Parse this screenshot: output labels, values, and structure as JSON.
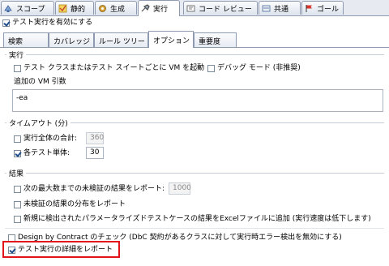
{
  "top_tabs": [
    {
      "label": "スコープ",
      "icon": "scope-icon"
    },
    {
      "label": "静的",
      "icon": "static-icon"
    },
    {
      "label": "生成",
      "icon": "generate-icon"
    },
    {
      "label": "実行",
      "icon": "execute-icon",
      "active": true
    },
    {
      "label": "コード レビュー",
      "icon": "code-review-icon"
    },
    {
      "label": "共通",
      "icon": "common-icon"
    },
    {
      "label": "ゴール",
      "icon": "goal-icon"
    }
  ],
  "enable_test_run": {
    "label": "テスト実行を有効にする",
    "checked": true
  },
  "sub_tabs": [
    "検索",
    "カバレッジ",
    "ルール ツリー",
    "オプション",
    "重要度"
  ],
  "active_sub_tab": "オプション",
  "execution": {
    "title": "実行",
    "launch_vm": {
      "label": "テスト クラスまたはテスト スイートごとに VM を起動",
      "checked": false
    },
    "debug_mode": {
      "label": "デバッグ モード (非推奨)",
      "checked": false
    },
    "vm_args_label": "追加の VM 引数",
    "vm_args_value": "-ea"
  },
  "timeout": {
    "title": "タイムアウト (分)",
    "total": {
      "label": "実行全体の合計:",
      "checked": false,
      "value": "360"
    },
    "per_test": {
      "label": "各テスト単体:",
      "checked": true,
      "value": "30"
    }
  },
  "results": {
    "title": "結果",
    "max_unverified": {
      "label": "次の最大数までの未検証の結果をレポート:",
      "checked": false,
      "value": "1000"
    },
    "report_distribution": {
      "label": "未検証の結果の分布をレポート",
      "checked": false
    },
    "report_excel": {
      "label": "新規に検出されたパラメータライズドテストケースの結果をExcelファイルに追加 (実行速度は低下します)",
      "checked": false
    }
  },
  "design_by_contract": {
    "label": "Design by Contract のチェック (DbC 契約があるクラスに対して実行時エラー検出を無効にする)",
    "checked": false
  },
  "detail_report": {
    "label": "テスト実行の詳細をレポート",
    "checked": true
  },
  "colors": {
    "highlight": "#e2131a",
    "tab_border": "#8e9ab0",
    "check": "#1d4d8a"
  }
}
